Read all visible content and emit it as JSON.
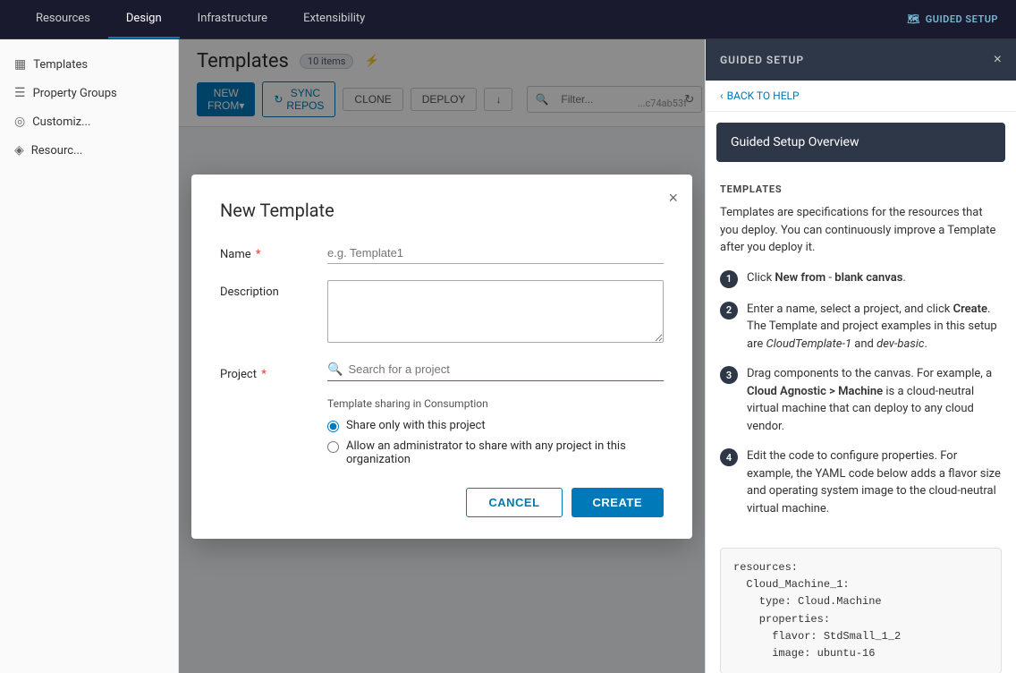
{
  "topNav": {
    "tabs": [
      {
        "label": "Resources",
        "active": false
      },
      {
        "label": "Design",
        "active": true
      },
      {
        "label": "Infrastructure",
        "active": false
      },
      {
        "label": "Extensibility",
        "active": false
      }
    ],
    "guidedSetupLabel": "GUIDED SETUP"
  },
  "sidebar": {
    "collapseIcon": "«",
    "items": [
      {
        "label": "Templates",
        "icon": "▦"
      },
      {
        "label": "Property Groups",
        "icon": "☰"
      },
      {
        "label": "Customiz...",
        "icon": "◎"
      },
      {
        "label": "Resourc...",
        "icon": "◈"
      }
    ]
  },
  "pageHeader": {
    "title": "Templates",
    "itemsCount": "10 items",
    "buttons": {
      "newFrom": "NEW FROM▾",
      "syncRepos": "SYNC REPOS",
      "clone": "CLONE",
      "deploy": "DEPLOY",
      "export": "↓"
    },
    "filterPlaceholder": "Filter..."
  },
  "hashText": "...c74ab53f",
  "modal": {
    "title": "New Template",
    "closeLabel": "×",
    "fields": {
      "name": {
        "label": "Name",
        "required": true,
        "placeholder": "e.g. Template1"
      },
      "description": {
        "label": "Description",
        "required": false,
        "placeholder": ""
      },
      "project": {
        "label": "Project",
        "required": true,
        "placeholder": "Search for a project"
      }
    },
    "sharingSection": {
      "title": "Template sharing in Consumption",
      "options": [
        {
          "label": "Share only with this project",
          "checked": true
        },
        {
          "label": "Allow an administrator to share with any project in this organization",
          "checked": false
        }
      ]
    },
    "buttons": {
      "cancel": "CANCEL",
      "create": "CREATE"
    }
  },
  "guidedPanel": {
    "title": "GUIDED SETUP",
    "closeLabel": "×",
    "backToHelp": "BACK TO HELP",
    "overviewTitle": "Guided Setup Overview",
    "templatesSection": {
      "label": "TEMPLATES",
      "description": "Templates are specifications for the resources that you deploy. You can continuously improve a Template after you deploy it.",
      "steps": [
        {
          "number": "1",
          "text": "Click New from - blank canvas."
        },
        {
          "number": "2",
          "text": "Enter a name, select a project, and click Create. The Template and project examples in this setup are CloudTemplate-1 and dev-basic."
        },
        {
          "number": "3",
          "text": "Drag components to the canvas. For example, a Cloud Agnostic > Machine is a cloud-neutral virtual machine that can deploy to any cloud vendor."
        },
        {
          "number": "4",
          "text": "Edit the code to configure properties. For example, the YAML code below adds a flavor size and operating system image to the cloud-neutral virtual machine."
        }
      ],
      "codeBlock": "resources:\n  Cloud_Machine_1:\n    type: Cloud.Machine\n    properties:\n      flavor: StdSmall_1_2\n      image: ubuntu-16"
    }
  }
}
